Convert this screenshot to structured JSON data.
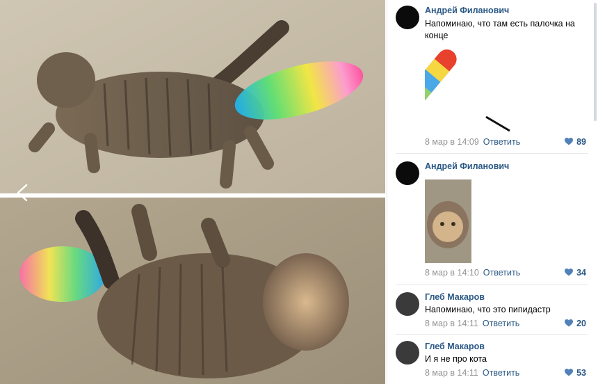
{
  "comments": [
    {
      "author": "Андрей Филанович",
      "text": "Напоминаю, что там есть палочка на конце",
      "date": "8 мар в 14:09",
      "reply": "Ответить",
      "likes": "89",
      "attachment": "duster-image"
    },
    {
      "author": "Андрей Филанович",
      "text": "",
      "date": "8 мар в 14:10",
      "reply": "Ответить",
      "likes": "34",
      "attachment": "cat-photo"
    },
    {
      "author": "Глеб Макаров",
      "text": "Напоминаю, что это пипидастр",
      "date": "8 мар в 14:11",
      "reply": "Ответить",
      "likes": "20"
    },
    {
      "author": "Глеб Макаров",
      "text": "И я не про кота",
      "date": "8 мар в 14:11",
      "reply": "Ответить",
      "likes": "53"
    }
  ],
  "icons": {
    "prev": "chevron-left-icon",
    "like": "heart-icon"
  },
  "colors": {
    "link": "#2a5885",
    "meta": "#939393",
    "divider": "#e7e8ec"
  }
}
